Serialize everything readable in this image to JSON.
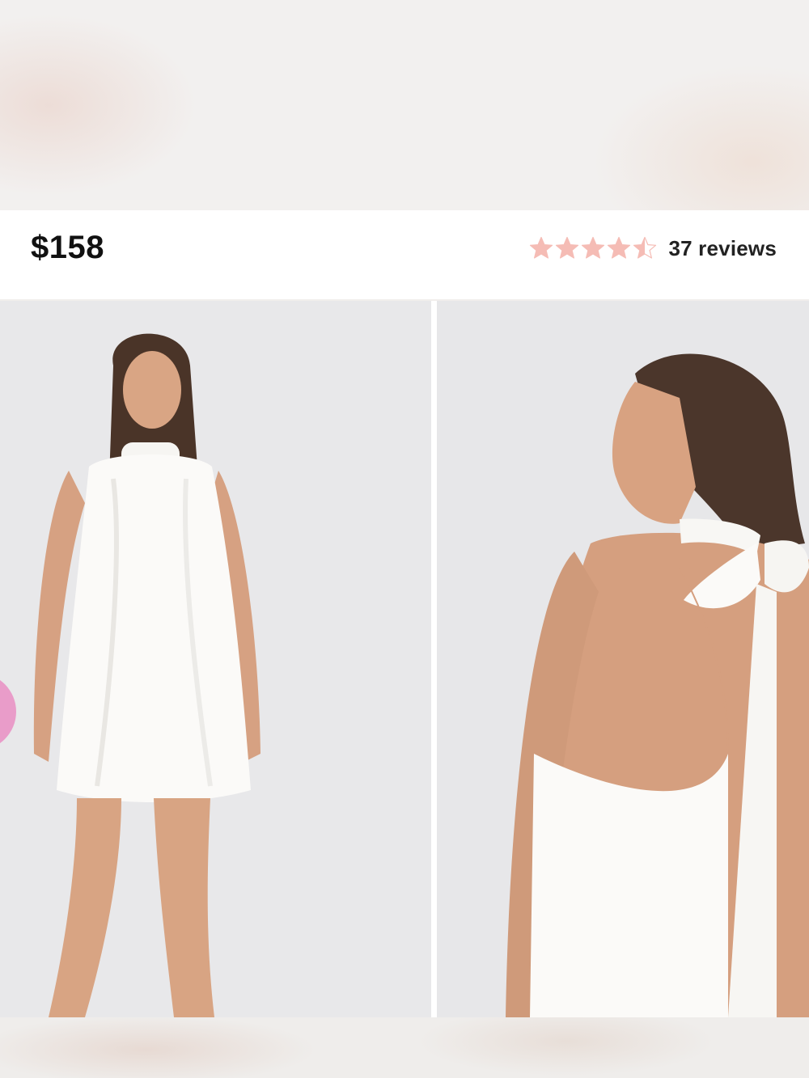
{
  "product": {
    "price": "$158",
    "rating": {
      "value": 4.5,
      "max": 5,
      "reviews_label": "37 reviews",
      "star_color": "#f5bcb5"
    }
  },
  "gallery": {
    "images": [
      {
        "alt": "front-view-photo"
      },
      {
        "alt": "back-view-photo"
      }
    ]
  },
  "colors": {
    "accent_pink": "#e99cc9"
  }
}
